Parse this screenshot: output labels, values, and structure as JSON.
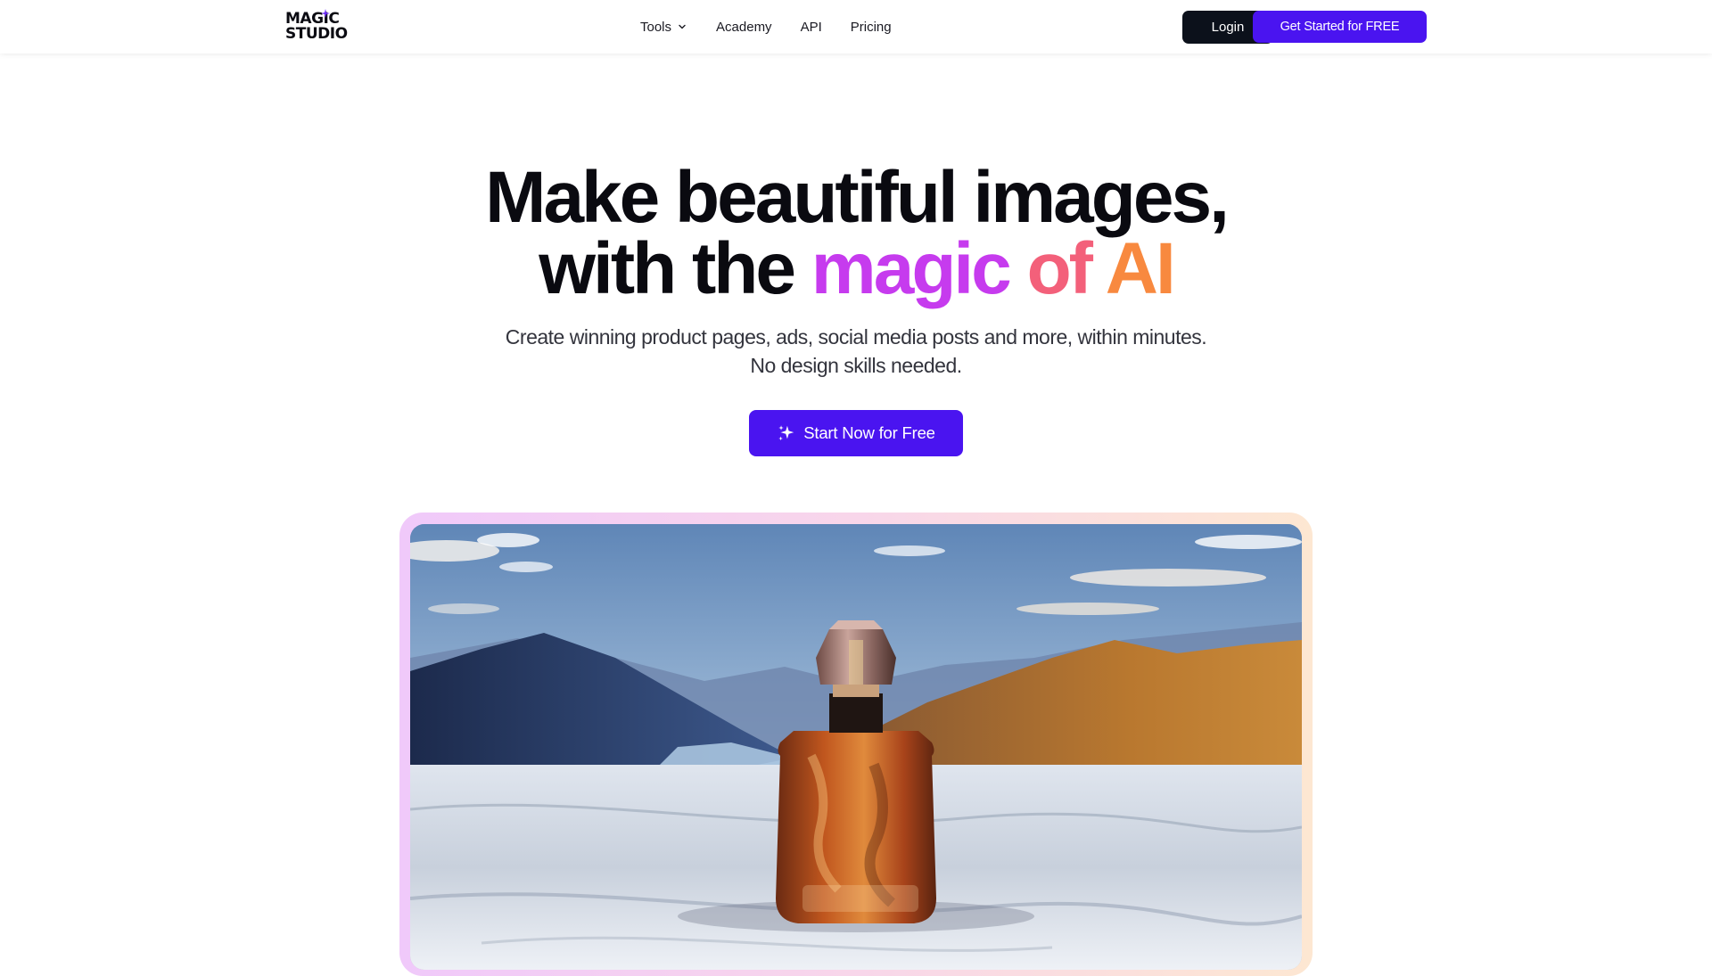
{
  "header": {
    "logo": {
      "line1": "MAGIC",
      "line2": "STUDIO"
    },
    "nav": [
      {
        "label": "Tools",
        "has_dropdown": true,
        "icon": "chevron-down-icon"
      },
      {
        "label": "Academy"
      },
      {
        "label": "API"
      },
      {
        "label": "Pricing"
      }
    ],
    "login_label": "Login",
    "cta_label": "Get Started for FREE"
  },
  "hero": {
    "title_line1": "Make beautiful images,",
    "title_line2_prefix": "with the",
    "title_magic": "magic",
    "title_of": "of",
    "title_ai": "AI",
    "subtitle_line1": "Create winning product pages, ads, social media posts and more, within minutes.",
    "subtitle_line2": "No design skills needed.",
    "start_label": "Start Now for Free",
    "start_icon": "sparkles-icon"
  },
  "showcase": {
    "image_subject": "perfume-bottle-on-marble-mountain-landscape"
  },
  "colors": {
    "primary": "#4a14f0",
    "dark": "#0c111b",
    "magic": "#c63bee",
    "of": "#f3607a",
    "ai": "#f8893f"
  }
}
